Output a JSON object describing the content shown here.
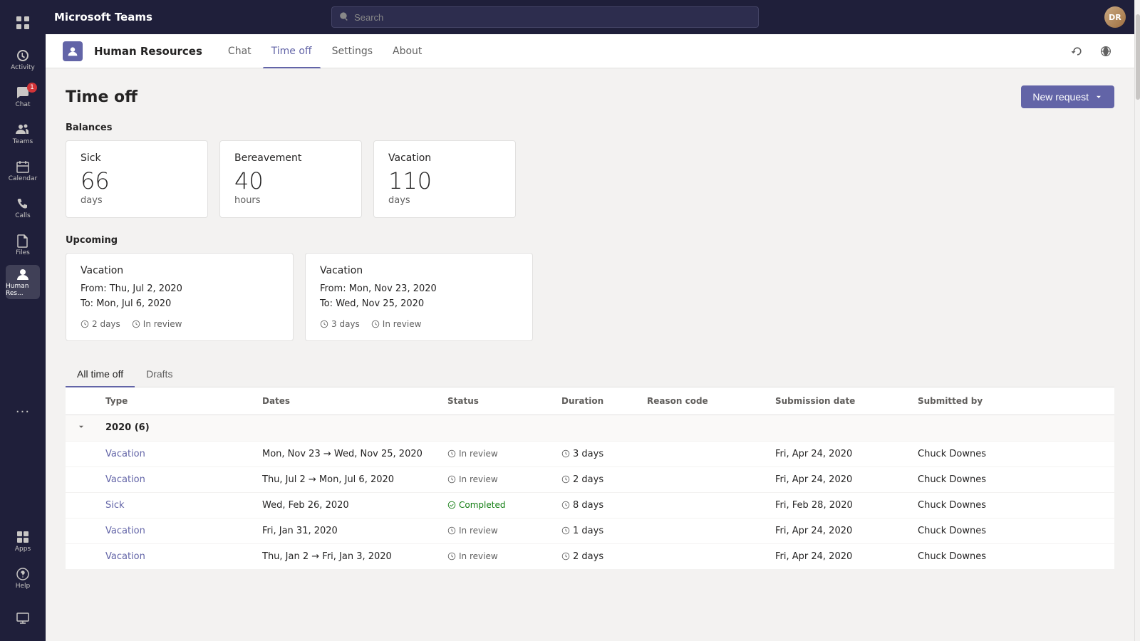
{
  "app": {
    "title": "Microsoft Teams",
    "search_placeholder": "Search"
  },
  "sidebar": {
    "items": [
      {
        "id": "grid",
        "label": "",
        "icon": "grid"
      },
      {
        "id": "activity",
        "label": "Activity",
        "icon": "activity"
      },
      {
        "id": "chat",
        "label": "Chat",
        "icon": "chat",
        "badge": "1"
      },
      {
        "id": "teams",
        "label": "Teams",
        "icon": "teams"
      },
      {
        "id": "calendar",
        "label": "Calendar",
        "icon": "calendar"
      },
      {
        "id": "calls",
        "label": "Calls",
        "icon": "calls"
      },
      {
        "id": "files",
        "label": "Files",
        "icon": "files"
      },
      {
        "id": "human-resources",
        "label": "Human Res...",
        "icon": "hr",
        "active": true
      }
    ],
    "bottom_items": [
      {
        "id": "more",
        "label": "...",
        "icon": "more"
      },
      {
        "id": "apps",
        "label": "Apps",
        "icon": "apps"
      },
      {
        "id": "help",
        "label": "Help",
        "icon": "help"
      },
      {
        "id": "feedback",
        "label": "",
        "icon": "feedback"
      }
    ]
  },
  "app_header": {
    "app_name": "Human Resources",
    "tabs": [
      {
        "id": "chat",
        "label": "Chat",
        "active": false
      },
      {
        "id": "time-off",
        "label": "Time off",
        "active": true
      },
      {
        "id": "settings",
        "label": "Settings",
        "active": false
      },
      {
        "id": "about",
        "label": "About",
        "active": false
      }
    ]
  },
  "page": {
    "title": "Time off",
    "new_request_label": "New request"
  },
  "balances": {
    "section_label": "Balances",
    "cards": [
      {
        "id": "sick",
        "title": "Sick",
        "number": "66",
        "unit": "days"
      },
      {
        "id": "bereavement",
        "title": "Bereavement",
        "number": "40",
        "unit": "hours"
      },
      {
        "id": "vacation",
        "title": "Vacation",
        "number": "110",
        "unit": "days"
      }
    ]
  },
  "upcoming": {
    "section_label": "Upcoming",
    "cards": [
      {
        "id": "upcoming-1",
        "title": "Vacation",
        "from": "From: Thu, Jul 2, 2020",
        "to": "To: Mon, Jul 6, 2020",
        "days": "2 days",
        "status": "In review"
      },
      {
        "id": "upcoming-2",
        "title": "Vacation",
        "from": "From: Mon, Nov 23, 2020",
        "to": "To: Wed, Nov 25, 2020",
        "days": "3 days",
        "status": "In review"
      }
    ]
  },
  "list_tabs": [
    {
      "id": "all-time-off",
      "label": "All time off",
      "active": true
    },
    {
      "id": "drafts",
      "label": "Drafts",
      "active": false
    }
  ],
  "table": {
    "columns": [
      {
        "id": "expand",
        "label": ""
      },
      {
        "id": "type",
        "label": "Type"
      },
      {
        "id": "dates",
        "label": "Dates"
      },
      {
        "id": "status",
        "label": "Status"
      },
      {
        "id": "duration",
        "label": "Duration"
      },
      {
        "id": "reason-code",
        "label": "Reason code"
      },
      {
        "id": "submission-date",
        "label": "Submission date"
      },
      {
        "id": "submitted-by",
        "label": "Submitted by"
      }
    ],
    "groups": [
      {
        "id": "2020",
        "label": "2020 (6)",
        "expanded": true,
        "rows": [
          {
            "id": "row-1",
            "type": "Vacation",
            "dates": "Mon, Nov 23 → Wed, Nov 25, 2020",
            "status": "In review",
            "status_type": "in-review",
            "duration": "3 days",
            "reason_code": "",
            "submission_date": "Fri, Apr 24, 2020",
            "submitted_by": "Chuck Downes"
          },
          {
            "id": "row-2",
            "type": "Vacation",
            "dates": "Thu, Jul 2 → Mon, Jul 6, 2020",
            "status": "In review",
            "status_type": "in-review",
            "duration": "2 days",
            "reason_code": "",
            "submission_date": "Fri, Apr 24, 2020",
            "submitted_by": "Chuck Downes"
          },
          {
            "id": "row-3",
            "type": "Sick",
            "dates": "Wed, Feb 26, 2020",
            "status": "Completed",
            "status_type": "completed",
            "duration": "8 days",
            "reason_code": "",
            "submission_date": "Fri, Feb 28, 2020",
            "submitted_by": "Chuck Downes"
          },
          {
            "id": "row-4",
            "type": "Vacation",
            "dates": "Fri, Jan 31, 2020",
            "status": "In review",
            "status_type": "in-review",
            "duration": "1 days",
            "reason_code": "",
            "submission_date": "Fri, Apr 24, 2020",
            "submitted_by": "Chuck Downes"
          },
          {
            "id": "row-5",
            "type": "Vacation",
            "dates": "Thu, Jan 2 → Fri, Jan 3, 2020",
            "status": "In review",
            "status_type": "in-review",
            "duration": "2 days",
            "reason_code": "",
            "submission_date": "Fri, Apr 24, 2020",
            "submitted_by": "Chuck Downes"
          }
        ]
      }
    ]
  }
}
